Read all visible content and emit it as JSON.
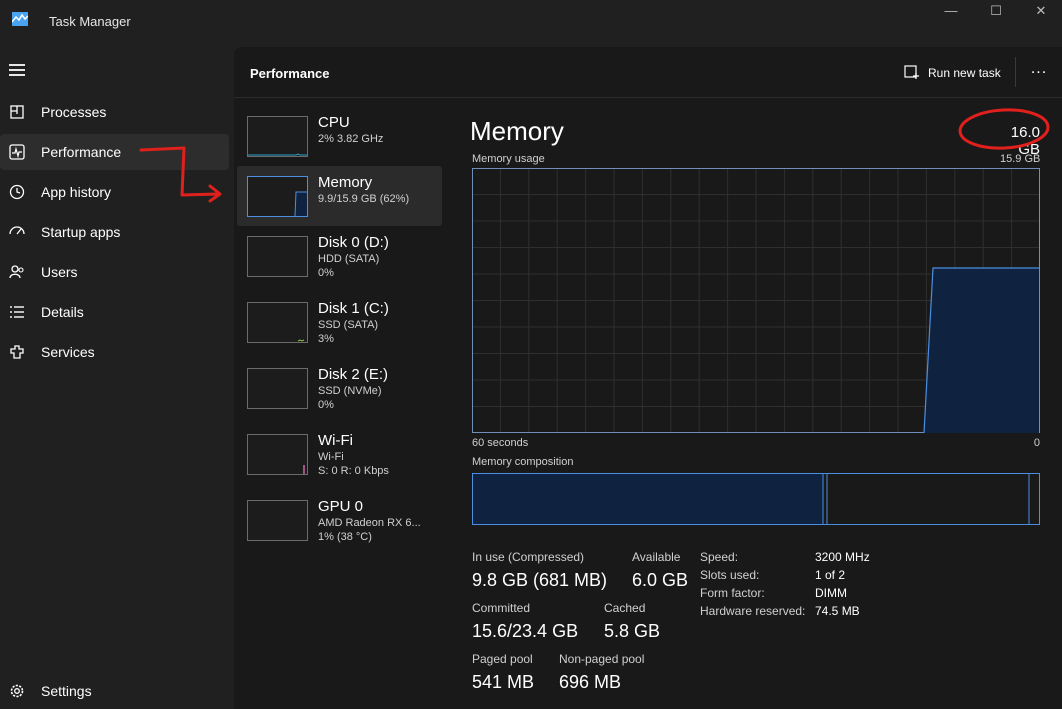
{
  "app": {
    "title": "Task Manager"
  },
  "window_controls": {
    "minimize": "—",
    "maximize": "☐",
    "close": "✕"
  },
  "sidebar": {
    "items": [
      {
        "label": "Processes",
        "icon": "processes-icon"
      },
      {
        "label": "Performance",
        "icon": "performance-icon",
        "active": true
      },
      {
        "label": "App history",
        "icon": "app-history-icon"
      },
      {
        "label": "Startup apps",
        "icon": "startup-apps-icon"
      },
      {
        "label": "Users",
        "icon": "users-icon"
      },
      {
        "label": "Details",
        "icon": "details-icon"
      },
      {
        "label": "Services",
        "icon": "services-icon"
      }
    ],
    "settings": {
      "label": "Settings",
      "icon": "gear-icon"
    }
  },
  "header": {
    "title": "Performance",
    "run_new_task": "Run new task",
    "more": "..."
  },
  "devices": [
    {
      "name": "CPU",
      "lines": [
        "2% 3.82 GHz"
      ]
    },
    {
      "name": "Memory",
      "lines": [
        "9.9/15.9 GB (62%)"
      ],
      "active": true
    },
    {
      "name": "Disk 0 (D:)",
      "lines": [
        "HDD (SATA)",
        "0%"
      ]
    },
    {
      "name": "Disk 1 (C:)",
      "lines": [
        "SSD (SATA)",
        "3%"
      ]
    },
    {
      "name": "Disk 2 (E:)",
      "lines": [
        "SSD (NVMe)",
        "0%"
      ]
    },
    {
      "name": "Wi-Fi",
      "lines": [
        "Wi-Fi",
        "S: 0 R: 0 Kbps"
      ]
    },
    {
      "name": "GPU 0",
      "lines": [
        "AMD Radeon RX 6...",
        "1% (38 °C)"
      ]
    }
  ],
  "memory": {
    "title": "Memory",
    "total": "16.0 GB",
    "usage_label": "Memory usage",
    "usage_max": "15.9 GB",
    "axis_left": "60 seconds",
    "axis_right": "0",
    "composition_label": "Memory composition",
    "stats": {
      "in_use_label": "In use (Compressed)",
      "in_use_value": "9.8 GB (681 MB)",
      "available_label": "Available",
      "available_value": "6.0 GB",
      "committed_label": "Committed",
      "committed_value": "15.6/23.4 GB",
      "cached_label": "Cached",
      "cached_value": "5.8 GB",
      "paged_label": "Paged pool",
      "paged_value": "541 MB",
      "nonpaged_label": "Non-paged pool",
      "nonpaged_value": "696 MB"
    },
    "specs": [
      {
        "label": "Speed:",
        "value": "3200 MHz"
      },
      {
        "label": "Slots used:",
        "value": "1 of 2"
      },
      {
        "label": "Form factor:",
        "value": "DIMM"
      },
      {
        "label": "Hardware reserved:",
        "value": "74.5 MB"
      }
    ]
  },
  "colors": {
    "accent": "#4c8ee0",
    "graph_fill": "#0f2340",
    "annotation": "#e0201c"
  }
}
